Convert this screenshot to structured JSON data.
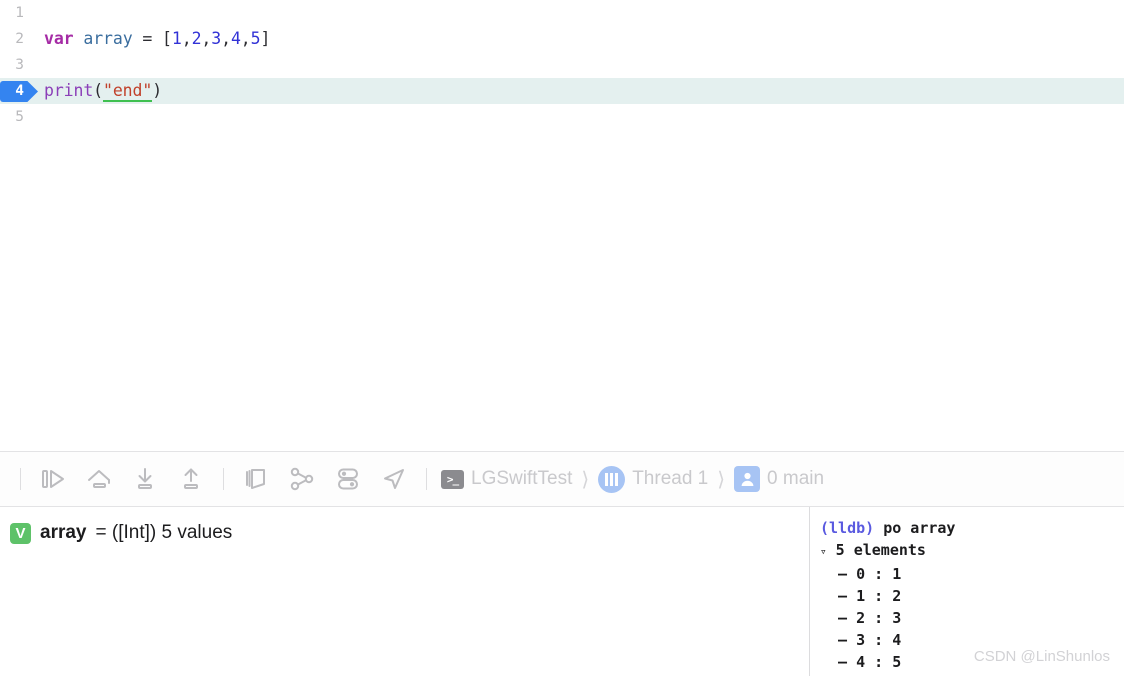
{
  "editor": {
    "lines": [
      {
        "num": "1",
        "current": false,
        "breakpoint": false,
        "tokens": []
      },
      {
        "num": "2",
        "current": false,
        "breakpoint": false,
        "tokens": [
          {
            "t": "kw",
            "v": "var"
          },
          {
            "t": "punc",
            "v": " "
          },
          {
            "t": "var",
            "v": "array"
          },
          {
            "t": "punc",
            "v": " = ["
          },
          {
            "t": "num",
            "v": "1"
          },
          {
            "t": "punc",
            "v": ","
          },
          {
            "t": "num",
            "v": "2"
          },
          {
            "t": "punc",
            "v": ","
          },
          {
            "t": "num",
            "v": "3"
          },
          {
            "t": "punc",
            "v": ","
          },
          {
            "t": "num",
            "v": "4"
          },
          {
            "t": "punc",
            "v": ","
          },
          {
            "t": "num",
            "v": "5"
          },
          {
            "t": "punc",
            "v": "]"
          }
        ],
        "text": "var array = [1,2,3,4,5]"
      },
      {
        "num": "3",
        "current": false,
        "breakpoint": false,
        "tokens": []
      },
      {
        "num": "4",
        "current": true,
        "breakpoint": true,
        "tokens": [
          {
            "t": "fn",
            "v": "print"
          },
          {
            "t": "punc",
            "v": "("
          },
          {
            "t": "str",
            "v": "\"end\""
          },
          {
            "t": "punc",
            "v": ")"
          }
        ],
        "text": "print(\"end\")"
      },
      {
        "num": "5",
        "current": false,
        "breakpoint": false,
        "tokens": []
      }
    ]
  },
  "debug_bar": {
    "buttons": [
      {
        "name": "continue-button",
        "label": "Continue program execution"
      },
      {
        "name": "step-over-button",
        "label": "Step over"
      },
      {
        "name": "step-into-button",
        "label": "Step into"
      },
      {
        "name": "step-out-button",
        "label": "Step out"
      },
      {
        "name": "view-hierarchy-button",
        "label": "Debug View Hierarchy"
      },
      {
        "name": "memory-graph-button",
        "label": "Debug Memory Graph"
      },
      {
        "name": "debug-settings-button",
        "label": "Environment Overrides"
      },
      {
        "name": "simulate-location-button",
        "label": "Simulate Location"
      }
    ],
    "breadcrumb": {
      "process": "LGSwiftTest",
      "thread": "Thread 1",
      "frame": "0 main",
      "terminal_glyph": ">_"
    }
  },
  "variables": {
    "badge": "V",
    "name": "array",
    "detail": "= ([Int]) 5 values"
  },
  "console": {
    "prompt": "(lldb)",
    "command": "po array",
    "header_disclosure": "▿",
    "header": "5 elements",
    "entries": [
      {
        "index": "0",
        "value": "1"
      },
      {
        "index": "1",
        "value": "2"
      },
      {
        "index": "2",
        "value": "3"
      },
      {
        "index": "3",
        "value": "4"
      },
      {
        "index": "4",
        "value": "5"
      }
    ],
    "watermark": "CSDN @LinShunlos"
  },
  "colors": {
    "accent_blue": "#3484f0",
    "current_line": "#e4f0ef",
    "variable_green": "#5ec269",
    "thread_blue": "#a7c4f4",
    "string_red": "#c1412b",
    "string_underline_green": "#3fc050",
    "keyword_purple": "#a52ba5",
    "number_blue": "#3232d6",
    "function_purple": "#8b3fb8",
    "toolbar_icon_gray": "#bcbcbf"
  }
}
